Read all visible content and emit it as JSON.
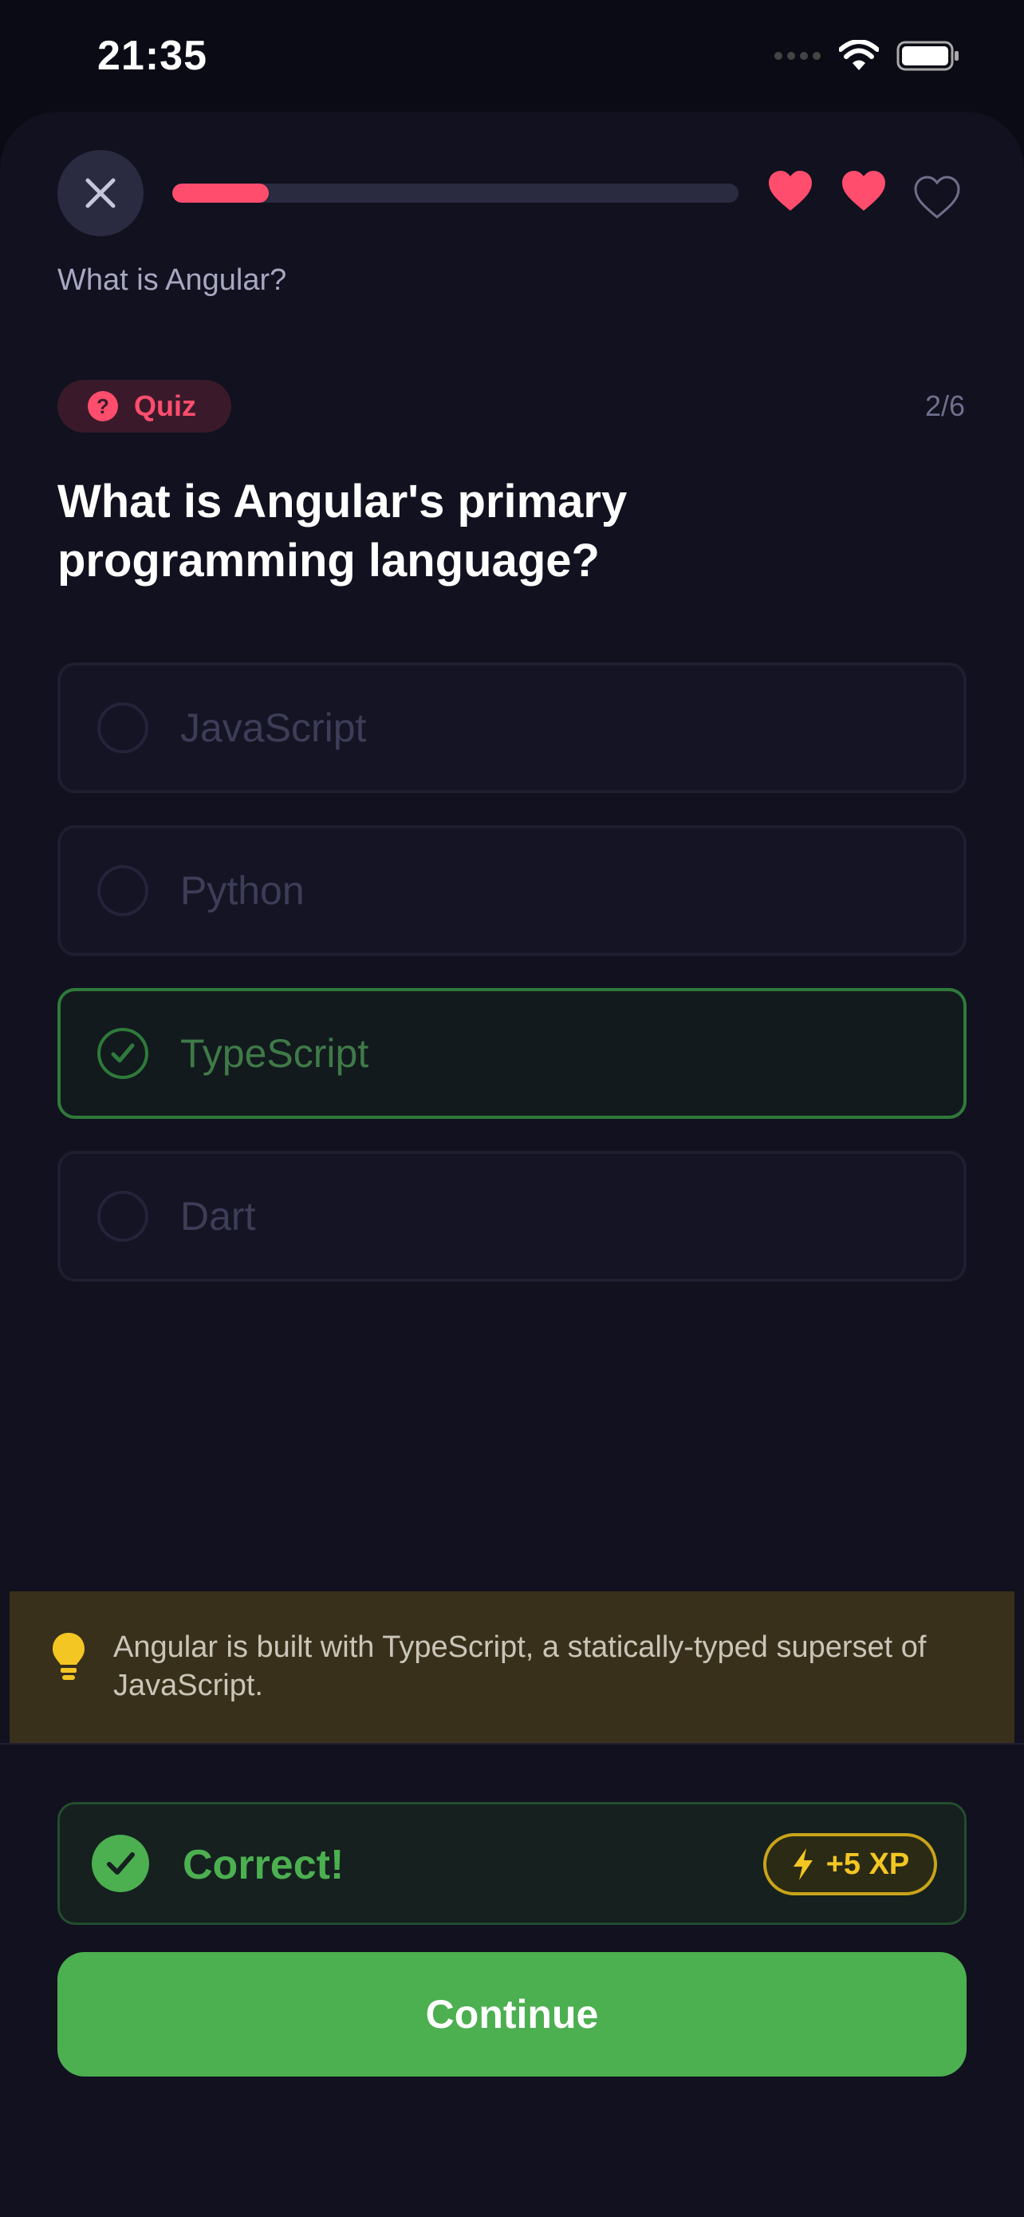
{
  "status_bar": {
    "time": "21:35"
  },
  "header": {
    "progress_fraction": 0.17,
    "hearts": [
      {
        "icon": "heart-filled-icon",
        "filled": true
      },
      {
        "icon": "heart-filled-icon",
        "filled": true
      },
      {
        "icon": "heart-outline-icon",
        "filled": false
      }
    ],
    "lesson_title": "What is Angular?"
  },
  "quiz": {
    "badge_label": "Quiz",
    "badge_icon_glyph": "?",
    "step": "2/6",
    "question": "What is Angular's primary programming language?",
    "options": [
      {
        "label": "JavaScript",
        "state": "disabled"
      },
      {
        "label": "Python",
        "state": "disabled"
      },
      {
        "label": "TypeScript",
        "state": "correct"
      },
      {
        "label": "Dart",
        "state": "disabled"
      }
    ]
  },
  "hint": {
    "icon": "lightbulb-icon",
    "text": "Angular is built with TypeScript, a statically-typed superset of JavaScript."
  },
  "result": {
    "label": "Correct!",
    "xp": "+5 XP"
  },
  "continue_label": "Continue",
  "colors": {
    "accent_red": "#ff4d6d",
    "success_green": "#4caf50",
    "xp_gold": "#f3c623",
    "background": "#11111f"
  }
}
